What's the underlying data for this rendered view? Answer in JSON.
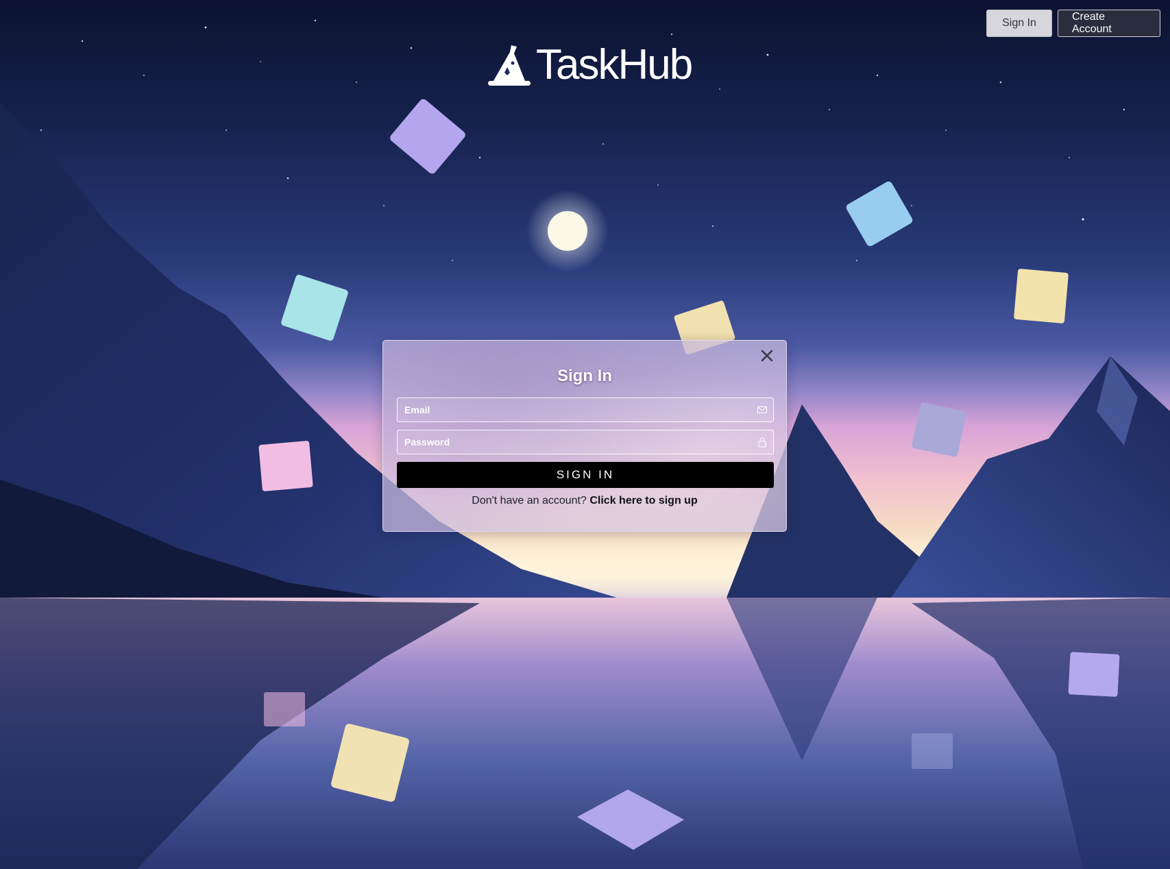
{
  "header": {
    "signin_label": "Sign In",
    "create_account_label": "Create Account"
  },
  "brand": {
    "name": "TaskHub",
    "icon": "wizard-hat-icon"
  },
  "modal": {
    "title": "Sign In",
    "close_icon": "close-icon",
    "email": {
      "placeholder": "Email",
      "value": "",
      "icon": "mail-icon"
    },
    "password": {
      "placeholder": "Password",
      "value": "",
      "icon": "lock-icon"
    },
    "submit_label": "SIGN IN",
    "signup_prompt": "Don't have an account?",
    "signup_link": "Click here to sign up"
  },
  "colors": {
    "submit_bg": "#000000",
    "create_account_bg": "#2a2d3e",
    "signin_top_bg": "#d6d6dc"
  }
}
